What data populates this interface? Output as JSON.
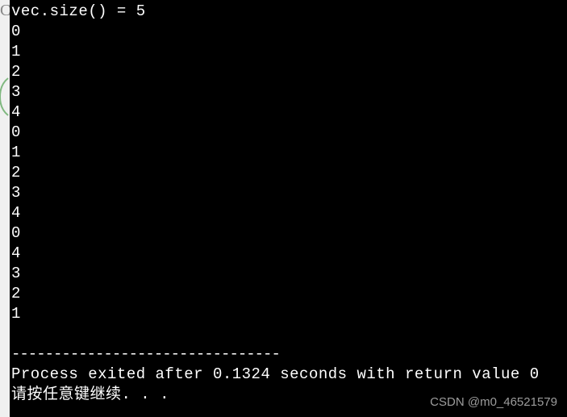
{
  "terminal": {
    "lines": [
      "vec.size() = 5",
      "0",
      "1",
      "2",
      "3",
      "4",
      "0",
      "1",
      "2",
      "3",
      "4",
      "0",
      "4",
      "3",
      "2",
      "1"
    ],
    "separator": "--------------------------------",
    "exit_message": "Process exited after 0.1324 seconds with return value 0",
    "continue_prompt": "请按任意键继续. . ."
  },
  "watermark": "CSDN @m0_46521579",
  "edge": {
    "letter": "C"
  }
}
